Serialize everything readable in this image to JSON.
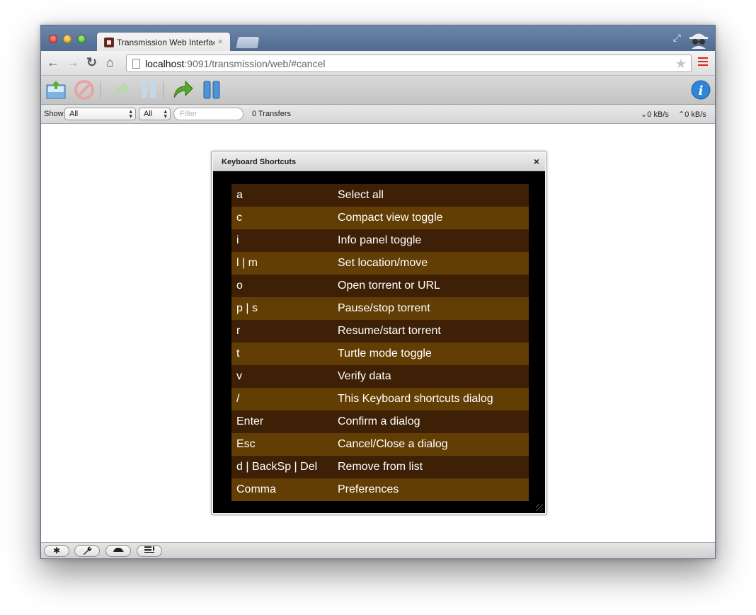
{
  "browser": {
    "tab_title": "Transmission Web Interface",
    "tab_close": "×",
    "url_host": "localhost",
    "url_rest": ":9091/transmission/web/#cancel"
  },
  "toolbar_icons": [
    "open-torrent-icon",
    "remove-icon",
    "resume-icon",
    "pause-icon",
    "resume-all-icon",
    "pause-all-icon",
    "info-icon"
  ],
  "filterbar": {
    "show_label": "Show",
    "state_select": "All",
    "tracker_select": "All",
    "filter_placeholder": "Filter",
    "transfers": "0 Transfers",
    "download_speed": "0 kB/s",
    "upload_speed": "0 kB/s"
  },
  "dialog": {
    "title": "Keyboard Shortcuts",
    "close": "×",
    "shortcuts": [
      {
        "key": "a",
        "action": "Select all"
      },
      {
        "key": "c",
        "action": "Compact view toggle"
      },
      {
        "key": "i",
        "action": "Info panel toggle"
      },
      {
        "key": "l | m",
        "action": "Set location/move"
      },
      {
        "key": "o",
        "action": "Open torrent or URL"
      },
      {
        "key": "p | s",
        "action": "Pause/stop torrent"
      },
      {
        "key": "r",
        "action": "Resume/start torrent"
      },
      {
        "key": "t",
        "action": "Turtle mode toggle"
      },
      {
        "key": "v",
        "action": "Verify data"
      },
      {
        "key": "/",
        "action": "This Keyboard shortcuts dialog"
      },
      {
        "key": "Enter",
        "action": "Confirm a dialog"
      },
      {
        "key": "Esc",
        "action": "Cancel/Close a dialog"
      },
      {
        "key": "d | BackSp | Del",
        "action": "Remove from list"
      },
      {
        "key": "Comma",
        "action": "Preferences"
      }
    ]
  },
  "bottombar": {
    "settings_icon": "✱",
    "preferences_icon": "wrench-icon",
    "turtle_icon": "turtle-icon",
    "compact_icon": "compact-view-icon"
  },
  "colors": {
    "row_dark": "#3e2006",
    "row_light": "#633e04",
    "titlebar": "#5a7499"
  }
}
